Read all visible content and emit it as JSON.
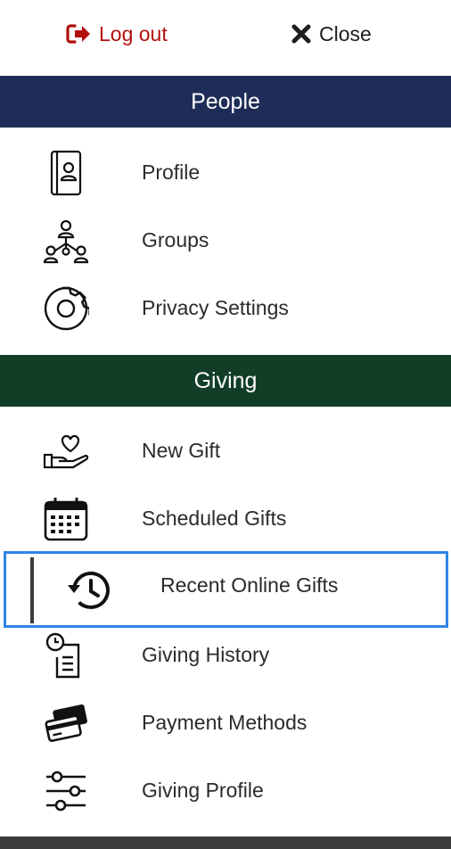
{
  "top": {
    "logout_label": "Log out",
    "close_label": "Close"
  },
  "colors": {
    "logout": "#b30f0f",
    "people_header": "#1e2d57",
    "giving_header": "#123e28",
    "selected_border": "#2c85e8"
  },
  "sections": [
    {
      "title": "People",
      "items": [
        {
          "label": "Profile",
          "icon": "contact-book-icon"
        },
        {
          "label": "Groups",
          "icon": "org-chart-icon"
        },
        {
          "label": "Privacy Settings",
          "icon": "gear-icon"
        }
      ]
    },
    {
      "title": "Giving",
      "items": [
        {
          "label": "New Gift",
          "icon": "heart-hand-icon"
        },
        {
          "label": "Scheduled Gifts",
          "icon": "calendar-icon"
        },
        {
          "label": "Recent Online Gifts",
          "icon": "history-icon",
          "selected": true
        },
        {
          "label": "Giving History",
          "icon": "clock-document-icon"
        },
        {
          "label": "Payment Methods",
          "icon": "credit-cards-icon"
        },
        {
          "label": "Giving Profile",
          "icon": "sliders-icon"
        }
      ]
    }
  ]
}
